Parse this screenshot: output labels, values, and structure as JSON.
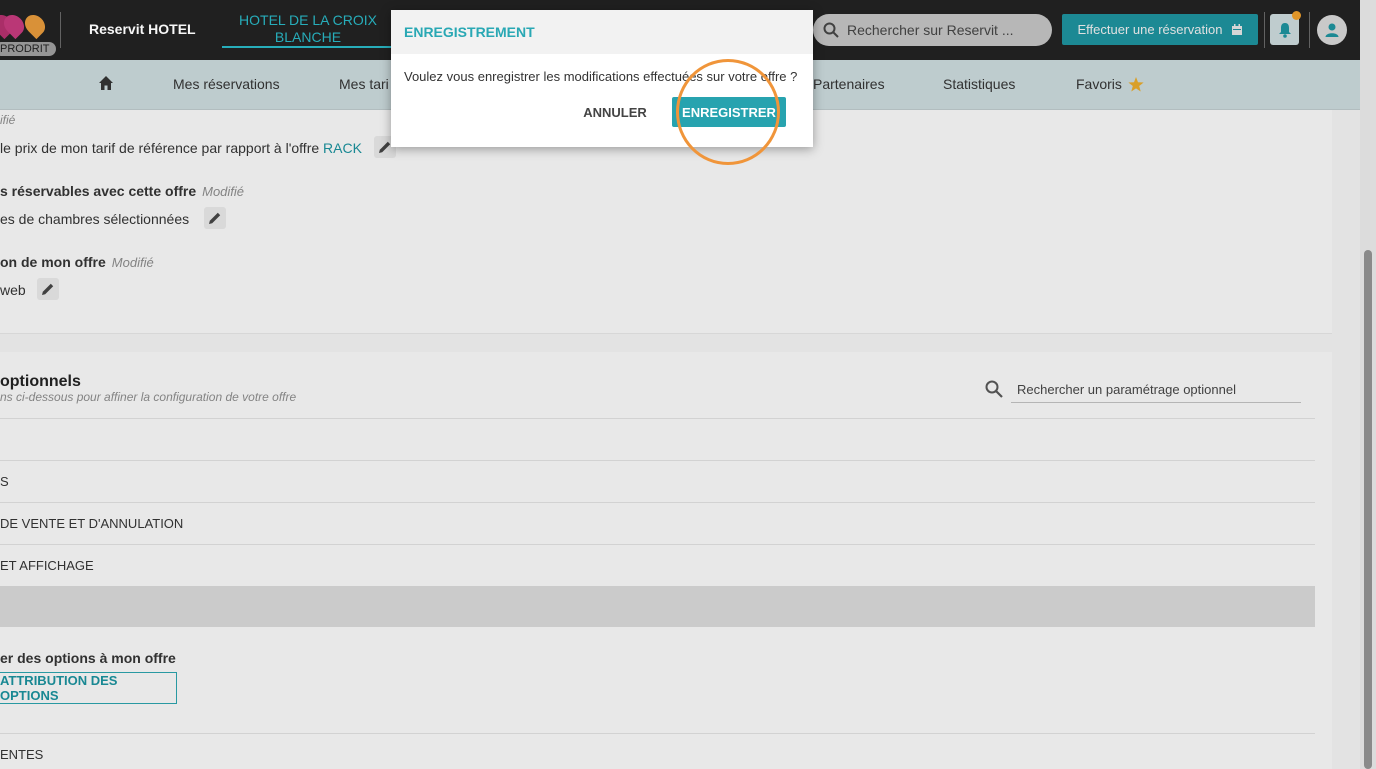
{
  "topbar": {
    "badge": "PRODRIT",
    "brand": "Reservit HOTEL",
    "hotel_name": "HOTEL DE LA CROIX BLANCHE",
    "search_placeholder": "Rechercher sur Reservit ...",
    "book_button": "Effectuer une réservation",
    "colors": {
      "accent": "#29b3c0",
      "bar": "#222222",
      "notification": "#e89a2a"
    }
  },
  "nav": {
    "items": [
      "Mes réservations",
      "Mes tari",
      "Partenaires",
      "Statistiques",
      "Favoris"
    ]
  },
  "panel1": {
    "modified_top": "ifié",
    "price_line": "le prix de mon tarif de référence par rapport à l'offre",
    "price_link": "RACK",
    "rooms_label": "s réservables avec cette offre",
    "rooms_modified": "Modifié",
    "rooms_value": "es de chambres sélectionnées",
    "distrib_label": "on de mon offre",
    "distrib_modified": "Modifié",
    "distrib_value": "web"
  },
  "panel2": {
    "title": "optionnels",
    "subtitle": "ns ci-dessous pour affiner la configuration de votre offre",
    "search_placeholder": "Rechercher un paramétrage optionnel",
    "rows": [
      "",
      "S",
      "DE VENTE ET D'ANNULATION",
      "ET AFFICHAGE"
    ],
    "options_label": "er des options à mon offre",
    "options_button": "ATTRIBUTION DES OPTIONS",
    "last_row": "ENTES"
  },
  "dialog": {
    "title": "ENREGISTREMENT",
    "message": "Voulez vous enregistrer les modifications effectuées sur votre offre ?",
    "cancel": "ANNULER",
    "save": "ENREGISTRER"
  }
}
